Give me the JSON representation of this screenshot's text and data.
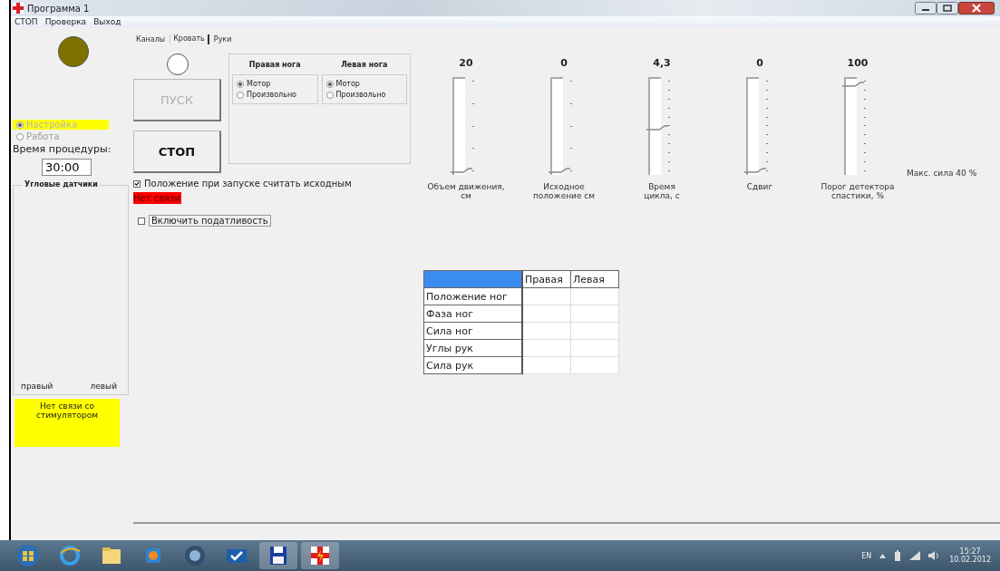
{
  "window": {
    "title": "Программа 1"
  },
  "menu": [
    "СТОП",
    "Проверка",
    "Выход"
  ],
  "mode_radios": [
    {
      "label": "Настройка",
      "selected": true,
      "disabled": true
    },
    {
      "label": "Работа",
      "selected": false,
      "disabled": true
    }
  ],
  "procedure_time": {
    "label": "Время процедуры:",
    "value": "30:00"
  },
  "angle_sensors": {
    "title": "Угловые датчики",
    "labels": [
      "правый",
      "левый"
    ]
  },
  "stimulator_status": "Нет связи со стимулятором",
  "tabs": [
    {
      "label": "Каналы",
      "selected": false
    },
    {
      "label": "Кровать",
      "selected": true
    },
    {
      "label": "Руки",
      "selected": false
    }
  ],
  "start_button": {
    "label": "ПУСК",
    "disabled": true
  },
  "stop_button": {
    "label": "СТОП",
    "disabled": false
  },
  "legs": [
    {
      "title": "Правая нога",
      "options": [
        {
          "label": "Мотор",
          "selected": true
        },
        {
          "label": "Произвольно",
          "selected": false
        }
      ]
    },
    {
      "title": "Левая нога",
      "options": [
        {
          "label": "Мотор",
          "selected": true
        },
        {
          "label": "Произвольно",
          "selected": false
        }
      ]
    }
  ],
  "start_position_checkbox": {
    "label": "Положение при запуске считать исходным",
    "checked": true
  },
  "connection_status": "Нет связи",
  "compliance_checkbox": {
    "label": "Включить податливость",
    "checked": false
  },
  "sliders": [
    {
      "value": "20",
      "level": 0,
      "label": "Объем движения, см"
    },
    {
      "value": "0",
      "level": 0,
      "label": "Исходное положение см"
    },
    {
      "value": "4,3",
      "level": 0.47,
      "label": "Время цикла, с"
    },
    {
      "value": "0",
      "level": 0,
      "label": "Сдвиг"
    },
    {
      "value": "100",
      "level": 0.95,
      "label": "Порог детектора спастики, %"
    }
  ],
  "max_force": "Макс. сила 40 %",
  "table": {
    "columns": [
      "Правая",
      "Левая"
    ],
    "rows": [
      "Положение ног",
      "Фаза ног",
      "Сила ног",
      "Углы рук",
      "Сила рук"
    ]
  },
  "taskbar": {
    "language": "EN",
    "time": "15:27",
    "date": "10.02.2012"
  }
}
